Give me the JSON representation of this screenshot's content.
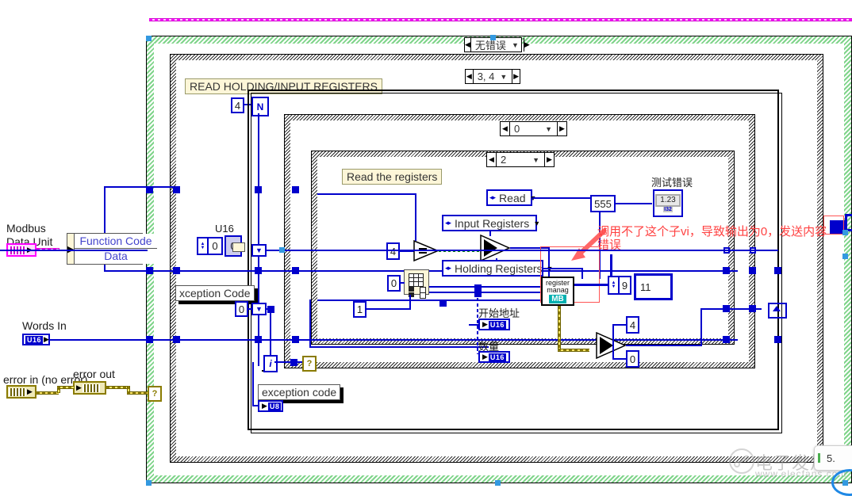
{
  "app": {
    "kind": "labview-block-diagram",
    "title": "Modbus READ HOLDING/INPUT REGISTERS block diagram"
  },
  "colors": {
    "wire_blue": "#0000cc",
    "wire_error": "#ffe96b",
    "wire_magenta": "#ff00ff",
    "structure_green": "#7fd48a",
    "annotation_red": "#ff4040",
    "subvi_badge": "#00b0b0",
    "label_tan": "#fdf6d8"
  },
  "case_selectors": [
    {
      "name": "outer-error-case",
      "value": "无错误"
    },
    {
      "name": "function-code-case",
      "value": "3, 4"
    },
    {
      "name": "inner-case-zero",
      "value": "0"
    },
    {
      "name": "inner-case-two",
      "value": "2"
    }
  ],
  "labels": {
    "read_holding_input_registers": "READ HOLDING/INPUT REGISTERS",
    "read_the_registers": "Read the registers",
    "exception_code_upper": "xception Code",
    "exception_code_lower": "exception code",
    "test_error": "测试错误",
    "start_address": "开始地址",
    "quantity": "数量",
    "u16_label": "U16"
  },
  "annotation": {
    "line1": "调用不了这个子vi，导致输出为0，发送内容",
    "line2": "错误",
    "color": "#ff4040"
  },
  "terminals": {
    "modbus_data_unit": {
      "line1": "Modbus",
      "line2": "Data Unit",
      "type": "cluster-magenta"
    },
    "words_in": {
      "label": "Words In",
      "type": "U16"
    },
    "error_in": {
      "label": "error in (no error)",
      "type": "error-cluster"
    },
    "error_out": {
      "label": "error out",
      "type": "error-cluster"
    },
    "start_address_ind": {
      "label": "开始地址",
      "type": "U16"
    },
    "quantity_ind": {
      "label": "数量",
      "type": "U16"
    },
    "exception_code_ind": {
      "label": "exception code",
      "type": "U8"
    }
  },
  "nodes": {
    "unbundle": {
      "row1": "Function Code",
      "row2": "Data"
    },
    "index_array": {
      "name": "index-array"
    },
    "equal_compare": {
      "glyph": "="
    },
    "select_node": {
      "glyph": "?"
    },
    "register_manager_subvi": {
      "line1": "register",
      "line2": "manag",
      "badge": "MB"
    },
    "numeric_indicator": {
      "value": "1.23",
      "type": "I32"
    }
  },
  "enums": {
    "read": "Read",
    "input_registers": "Input Registers",
    "holding_registers": "Holding Registers"
  },
  "constants": {
    "loop_count_n": "4",
    "u16_spin": "0",
    "u16_const": "0",
    "zero_a": "0",
    "zero_b": "0",
    "compare_four": "4",
    "index_zero": "0",
    "index_one": "1",
    "test_error_value": "555",
    "select_true": "4",
    "select_false": "0",
    "nine": "9",
    "eleven": "11"
  },
  "watermark": {
    "site_cn": "电子发烧友",
    "site_url": "www.elecfans.com"
  },
  "toast": {
    "text": "5."
  }
}
